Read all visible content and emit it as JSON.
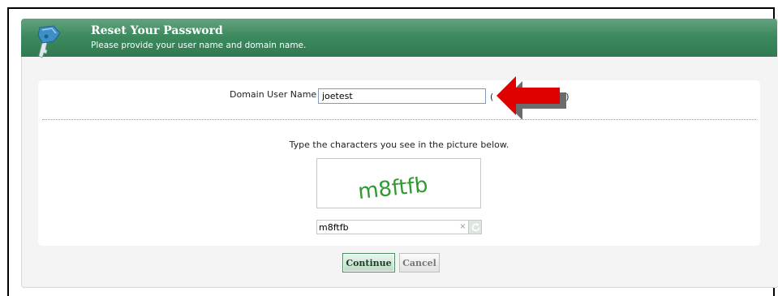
{
  "header": {
    "title": "Reset Your Password",
    "subtitle": "Please provide your user name and domain name.",
    "icon": "key-icon",
    "color": "#3e8a5f"
  },
  "form": {
    "username_label": "Domain User Name",
    "username_value": "joetest",
    "username_hint_start": "(",
    "username_hint_end": "th)",
    "captcha_instruction": "Type the characters you see in the picture below.",
    "captcha_image_text": "m8ftfb",
    "captcha_value": "m8ftfb",
    "captcha_clear": "×",
    "captcha_refresh_icon": "refresh-icon"
  },
  "buttons": {
    "continue_label": "Continue",
    "cancel_label": "Cancel"
  },
  "annotation": {
    "icon": "red-arrow-icon",
    "color": "#e00000"
  }
}
